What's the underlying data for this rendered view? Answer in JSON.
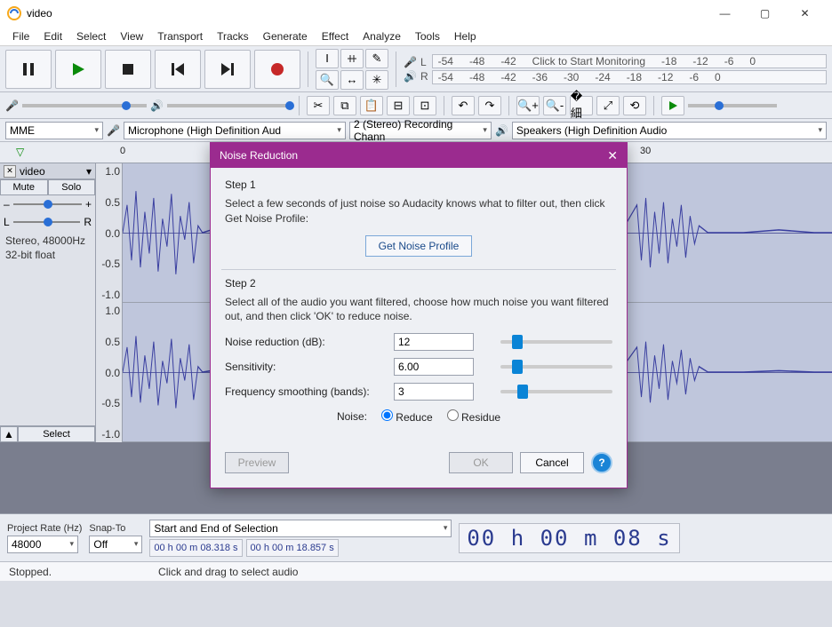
{
  "window": {
    "title": "video"
  },
  "menu": [
    "File",
    "Edit",
    "Select",
    "View",
    "Transport",
    "Tracks",
    "Generate",
    "Effect",
    "Analyze",
    "Tools",
    "Help"
  ],
  "meters": {
    "rec_ticks": [
      "-54",
      "-48",
      "-42"
    ],
    "rec_hint": "Click to Start Monitoring",
    "rec_ticks2": [
      "-18",
      "-12",
      "-6",
      "0"
    ],
    "play_ticks": [
      "-54",
      "-48",
      "-42",
      "-36",
      "-30",
      "-24",
      "-18",
      "-12",
      "-6",
      "0"
    ]
  },
  "devices": {
    "host": "MME",
    "input": "Microphone (High Definition Aud",
    "channels": "2 (Stereo) Recording Chann",
    "output": "Speakers (High Definition Audio"
  },
  "timeline": {
    "t0": "0",
    "t30": "30"
  },
  "track": {
    "name": "video",
    "mute": "Mute",
    "solo": "Solo",
    "gain_left": "–",
    "gain_right": "+",
    "pan_left": "L",
    "pan_right": "R",
    "info1": "Stereo, 48000Hz",
    "info2": "32-bit float",
    "select": "Select",
    "scale": [
      "1.0",
      "0.5",
      "0.0",
      "-0.5",
      "-1.0"
    ]
  },
  "bottom": {
    "rate_label": "Project Rate (Hz)",
    "rate_value": "48000",
    "snap_label": "Snap-To",
    "snap_value": "Off",
    "sel_label": "Start and End of Selection",
    "sel_start": "00 h 00 m 08.318 s",
    "sel_end": "00 h 00 m 18.857 s",
    "big_time": "00 h 00 m 08 s"
  },
  "status": {
    "left": "Stopped.",
    "right": "Click and drag to select audio"
  },
  "dialog": {
    "title": "Noise Reduction",
    "step1": "Step 1",
    "step1_desc": "Select a few seconds of just noise so Audacity knows what to filter out, then click Get Noise Profile:",
    "profile_btn": "Get Noise Profile",
    "step2": "Step 2",
    "step2_desc": "Select all of the audio you want filtered, choose how much noise you want filtered out, and then click 'OK' to reduce noise.",
    "nr_label": "Noise reduction (dB):",
    "nr_val": "12",
    "sens_label": "Sensitivity:",
    "sens_val": "6.00",
    "freq_label": "Frequency smoothing (bands):",
    "freq_val": "3",
    "noise_label": "Noise:",
    "reduce": "Reduce",
    "residue": "Residue",
    "preview": "Preview",
    "ok": "OK",
    "cancel": "Cancel"
  }
}
